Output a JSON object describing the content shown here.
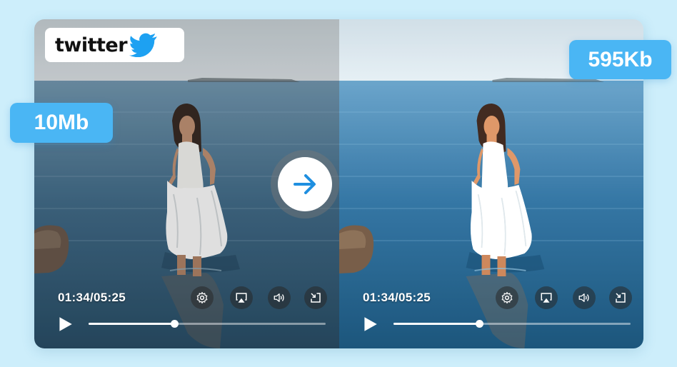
{
  "logo": {
    "text": "twitter",
    "icon": "twitter-bird-icon",
    "color": "#1da1f2"
  },
  "badges": {
    "original_size": "10Mb",
    "compressed_size": "595Kb",
    "color": "#4ab6f4"
  },
  "arrow": {
    "icon": "arrow-right-icon",
    "color": "#1f8fe0"
  },
  "players": [
    {
      "time": "01:34/05:25",
      "progress": 0.36,
      "controls": [
        "gear-icon",
        "airplay-icon",
        "volume-icon",
        "exit-fullscreen-icon"
      ]
    },
    {
      "time": "01:34/05:25",
      "progress": 0.36,
      "controls": [
        "gear-icon",
        "airplay-icon",
        "volume-icon",
        "exit-fullscreen-icon"
      ]
    }
  ]
}
